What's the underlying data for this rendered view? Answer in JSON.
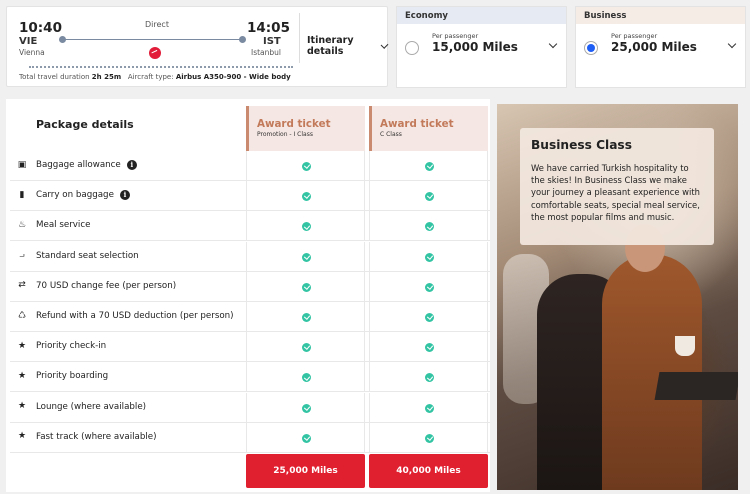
{
  "flight": {
    "depart_time": "10:40",
    "depart_code": "VIE",
    "depart_city": "Vienna",
    "arrive_time": "14:05",
    "arrive_code": "IST",
    "arrive_city": "Istanbul",
    "stop_type": "Direct",
    "itinerary_label": "Itinerary details",
    "duration_label": "Total travel duration",
    "duration_value": "2h 25m",
    "aircraft_label": "Aircraft type:",
    "aircraft_value": "Airbus A350-900 - Wide body"
  },
  "fares": {
    "economy": {
      "name": "Economy",
      "per_passenger": "Per passenger",
      "miles": "15,000 Miles",
      "selected": false
    },
    "business": {
      "name": "Business",
      "per_passenger": "Per passenger",
      "miles": "25,000 Miles",
      "selected": true
    }
  },
  "packages": {
    "title": "Package details",
    "columns": [
      {
        "title": "Award ticket",
        "subtitle": "Promotion - I Class",
        "price": "25,000 Miles"
      },
      {
        "title": "Award ticket",
        "subtitle": "C Class",
        "price": "40,000 Miles"
      }
    ],
    "rows": [
      {
        "icon": "baggage-icon",
        "label": "Baggage allowance",
        "info": true
      },
      {
        "icon": "carry-on-icon",
        "label": "Carry on baggage",
        "info": true
      },
      {
        "icon": "meal-icon",
        "label": "Meal service"
      },
      {
        "icon": "seat-icon",
        "label": "Standard seat selection"
      },
      {
        "icon": "change-fee-icon",
        "label": "70 USD change fee (per person)"
      },
      {
        "icon": "refund-icon",
        "label": "Refund with a 70 USD deduction (per person)"
      },
      {
        "icon": "star-icon",
        "label": "Priority check-in"
      },
      {
        "icon": "star-icon",
        "label": "Priority boarding"
      },
      {
        "icon": "star-icon",
        "label": "Lounge (where available)"
      },
      {
        "icon": "star-icon",
        "label": "Fast track (where available)"
      }
    ]
  },
  "promo": {
    "title": "Business Class",
    "text": "We have carried Turkish hospitality to the skies! In Business Class we make your journey a pleasant experience with comfortable seats, special meal service, the most popular films and music."
  },
  "colors": {
    "accent_red": "#e01f2f",
    "check_green": "#33c4a4",
    "award_brown": "#c27a5a",
    "radio_blue": "#1f5ef5"
  }
}
